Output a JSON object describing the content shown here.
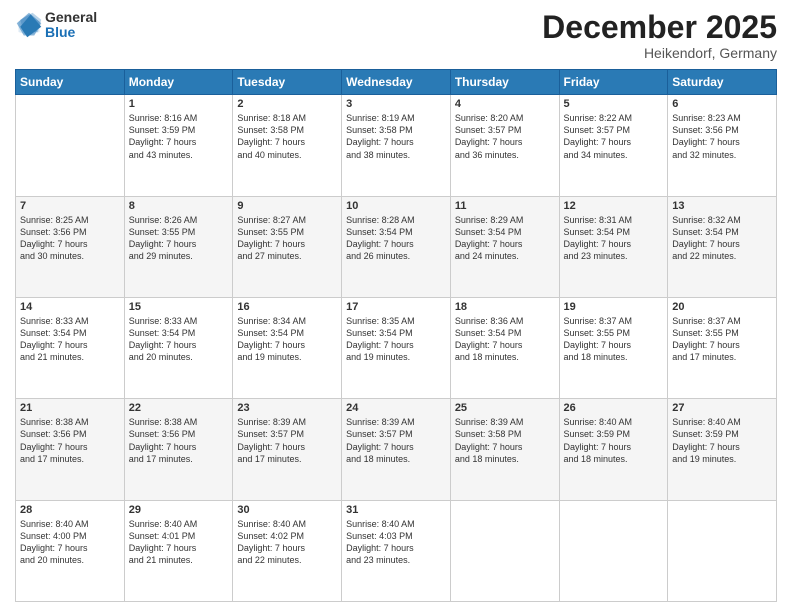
{
  "header": {
    "logo": {
      "general": "General",
      "blue": "Blue"
    },
    "title": "December 2025",
    "subtitle": "Heikendorf, Germany"
  },
  "calendar": {
    "days_of_week": [
      "Sunday",
      "Monday",
      "Tuesday",
      "Wednesday",
      "Thursday",
      "Friday",
      "Saturday"
    ],
    "weeks": [
      [
        {
          "day": "",
          "info": ""
        },
        {
          "day": "1",
          "info": "Sunrise: 8:16 AM\nSunset: 3:59 PM\nDaylight: 7 hours\nand 43 minutes."
        },
        {
          "day": "2",
          "info": "Sunrise: 8:18 AM\nSunset: 3:58 PM\nDaylight: 7 hours\nand 40 minutes."
        },
        {
          "day": "3",
          "info": "Sunrise: 8:19 AM\nSunset: 3:58 PM\nDaylight: 7 hours\nand 38 minutes."
        },
        {
          "day": "4",
          "info": "Sunrise: 8:20 AM\nSunset: 3:57 PM\nDaylight: 7 hours\nand 36 minutes."
        },
        {
          "day": "5",
          "info": "Sunrise: 8:22 AM\nSunset: 3:57 PM\nDaylight: 7 hours\nand 34 minutes."
        },
        {
          "day": "6",
          "info": "Sunrise: 8:23 AM\nSunset: 3:56 PM\nDaylight: 7 hours\nand 32 minutes."
        }
      ],
      [
        {
          "day": "7",
          "info": "Sunrise: 8:25 AM\nSunset: 3:56 PM\nDaylight: 7 hours\nand 30 minutes."
        },
        {
          "day": "8",
          "info": "Sunrise: 8:26 AM\nSunset: 3:55 PM\nDaylight: 7 hours\nand 29 minutes."
        },
        {
          "day": "9",
          "info": "Sunrise: 8:27 AM\nSunset: 3:55 PM\nDaylight: 7 hours\nand 27 minutes."
        },
        {
          "day": "10",
          "info": "Sunrise: 8:28 AM\nSunset: 3:54 PM\nDaylight: 7 hours\nand 26 minutes."
        },
        {
          "day": "11",
          "info": "Sunrise: 8:29 AM\nSunset: 3:54 PM\nDaylight: 7 hours\nand 24 minutes."
        },
        {
          "day": "12",
          "info": "Sunrise: 8:31 AM\nSunset: 3:54 PM\nDaylight: 7 hours\nand 23 minutes."
        },
        {
          "day": "13",
          "info": "Sunrise: 8:32 AM\nSunset: 3:54 PM\nDaylight: 7 hours\nand 22 minutes."
        }
      ],
      [
        {
          "day": "14",
          "info": "Sunrise: 8:33 AM\nSunset: 3:54 PM\nDaylight: 7 hours\nand 21 minutes."
        },
        {
          "day": "15",
          "info": "Sunrise: 8:33 AM\nSunset: 3:54 PM\nDaylight: 7 hours\nand 20 minutes."
        },
        {
          "day": "16",
          "info": "Sunrise: 8:34 AM\nSunset: 3:54 PM\nDaylight: 7 hours\nand 19 minutes."
        },
        {
          "day": "17",
          "info": "Sunrise: 8:35 AM\nSunset: 3:54 PM\nDaylight: 7 hours\nand 19 minutes."
        },
        {
          "day": "18",
          "info": "Sunrise: 8:36 AM\nSunset: 3:54 PM\nDaylight: 7 hours\nand 18 minutes."
        },
        {
          "day": "19",
          "info": "Sunrise: 8:37 AM\nSunset: 3:55 PM\nDaylight: 7 hours\nand 18 minutes."
        },
        {
          "day": "20",
          "info": "Sunrise: 8:37 AM\nSunset: 3:55 PM\nDaylight: 7 hours\nand 17 minutes."
        }
      ],
      [
        {
          "day": "21",
          "info": "Sunrise: 8:38 AM\nSunset: 3:56 PM\nDaylight: 7 hours\nand 17 minutes."
        },
        {
          "day": "22",
          "info": "Sunrise: 8:38 AM\nSunset: 3:56 PM\nDaylight: 7 hours\nand 17 minutes."
        },
        {
          "day": "23",
          "info": "Sunrise: 8:39 AM\nSunset: 3:57 PM\nDaylight: 7 hours\nand 17 minutes."
        },
        {
          "day": "24",
          "info": "Sunrise: 8:39 AM\nSunset: 3:57 PM\nDaylight: 7 hours\nand 18 minutes."
        },
        {
          "day": "25",
          "info": "Sunrise: 8:39 AM\nSunset: 3:58 PM\nDaylight: 7 hours\nand 18 minutes."
        },
        {
          "day": "26",
          "info": "Sunrise: 8:40 AM\nSunset: 3:59 PM\nDaylight: 7 hours\nand 18 minutes."
        },
        {
          "day": "27",
          "info": "Sunrise: 8:40 AM\nSunset: 3:59 PM\nDaylight: 7 hours\nand 19 minutes."
        }
      ],
      [
        {
          "day": "28",
          "info": "Sunrise: 8:40 AM\nSunset: 4:00 PM\nDaylight: 7 hours\nand 20 minutes."
        },
        {
          "day": "29",
          "info": "Sunrise: 8:40 AM\nSunset: 4:01 PM\nDaylight: 7 hours\nand 21 minutes."
        },
        {
          "day": "30",
          "info": "Sunrise: 8:40 AM\nSunset: 4:02 PM\nDaylight: 7 hours\nand 22 minutes."
        },
        {
          "day": "31",
          "info": "Sunrise: 8:40 AM\nSunset: 4:03 PM\nDaylight: 7 hours\nand 23 minutes."
        },
        {
          "day": "",
          "info": ""
        },
        {
          "day": "",
          "info": ""
        },
        {
          "day": "",
          "info": ""
        }
      ]
    ]
  }
}
